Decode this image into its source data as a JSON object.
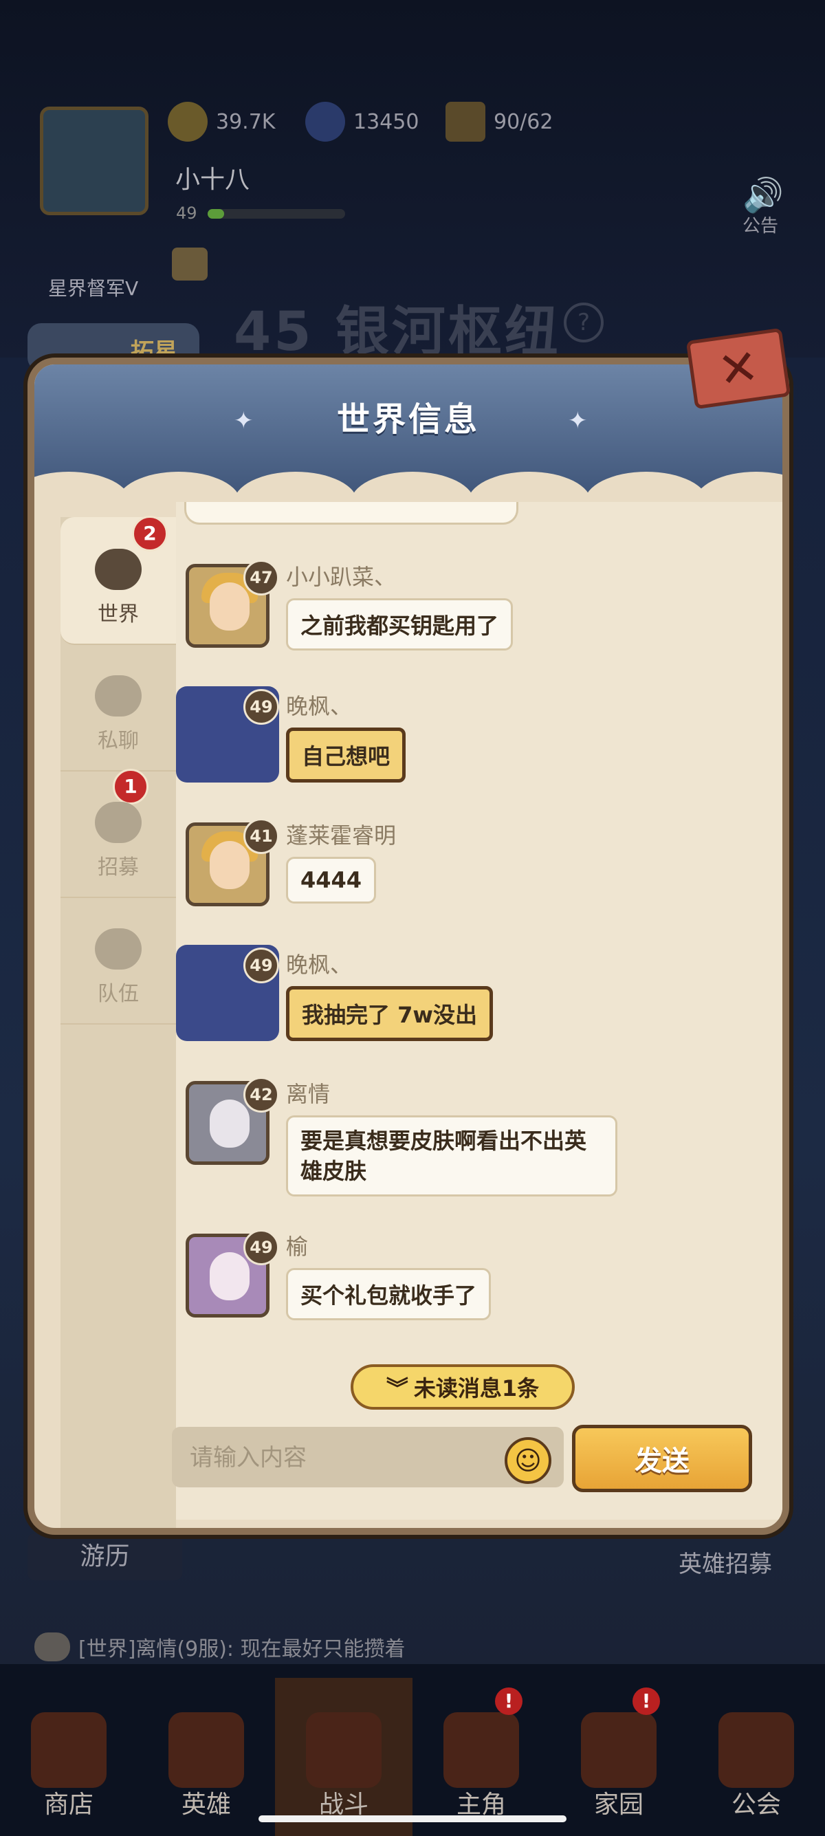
{
  "header": {
    "resources": [
      {
        "icon": "gold-coin-icon",
        "value": "39.7K"
      },
      {
        "icon": "star-gem-icon",
        "value": "13450"
      },
      {
        "icon": "energy-cracker-icon",
        "value": "90/62"
      }
    ],
    "player_name": "小十八",
    "player_level": "49",
    "vip_label": "星界督军V",
    "notice_label": "公告"
  },
  "stage": {
    "title": "45 银河枢纽",
    "help": "?",
    "expand_label": "拓星"
  },
  "dialog": {
    "title": "世界信息",
    "close_icon": "close-icon",
    "tabs": [
      {
        "label": "世界",
        "icon": "planet-icon",
        "badge": "2",
        "active": true
      },
      {
        "label": "私聊",
        "icon": "speech-bubble-icon",
        "badge": "",
        "active": false
      },
      {
        "label": "招募",
        "icon": "flag-icon",
        "badge": "1",
        "active": false
      },
      {
        "label": "队伍",
        "icon": "team-icon",
        "badge": "",
        "active": false
      }
    ],
    "messages": [
      {
        "name": "小小趴菜、",
        "level": "47",
        "text": "之前我都买钥匙用了",
        "style": "normal"
      },
      {
        "name": "晚枫、",
        "level": "49",
        "text": "自己想吧",
        "style": "gold"
      },
      {
        "name": "蓬莱霍睿明",
        "level": "41",
        "text": "4444",
        "style": "normal"
      },
      {
        "name": "晚枫、",
        "level": "49",
        "text": "我抽完了 7w没出",
        "style": "gold"
      },
      {
        "name": "离情",
        "level": "42",
        "text": "要是真想要皮肤啊看出不出英雄皮肤",
        "style": "normal"
      },
      {
        "name": "榆",
        "level": "49",
        "text": "买个礼包就收手了",
        "style": "normal"
      }
    ],
    "unread_label": "未读消息1条",
    "input_placeholder": "请输入内容",
    "send_label": "发送"
  },
  "side_buttons": {
    "left": "游历",
    "right": "英雄招募"
  },
  "ticker": "[世界]离情(9服): 现在最好只能攒着",
  "bottom_nav": [
    {
      "label": "商店",
      "icon": "shop-icon",
      "active": false,
      "badge": ""
    },
    {
      "label": "英雄",
      "icon": "hero-cards-icon",
      "active": false,
      "badge": ""
    },
    {
      "label": "战斗",
      "icon": "battle-sword-icon",
      "active": true,
      "badge": ""
    },
    {
      "label": "主角",
      "icon": "protagonist-icon",
      "active": false,
      "badge": "!"
    },
    {
      "label": "家园",
      "icon": "castle-icon",
      "active": false,
      "badge": "!"
    },
    {
      "label": "公会",
      "icon": "guild-icon",
      "active": false,
      "badge": ""
    }
  ],
  "colors": {
    "dialog_paper": "#e9dcc5",
    "dialog_header": "#4e6690",
    "gold_bubble": "#f3d27a",
    "send_button": "#eeb444",
    "badge_red": "#c42a2a"
  }
}
